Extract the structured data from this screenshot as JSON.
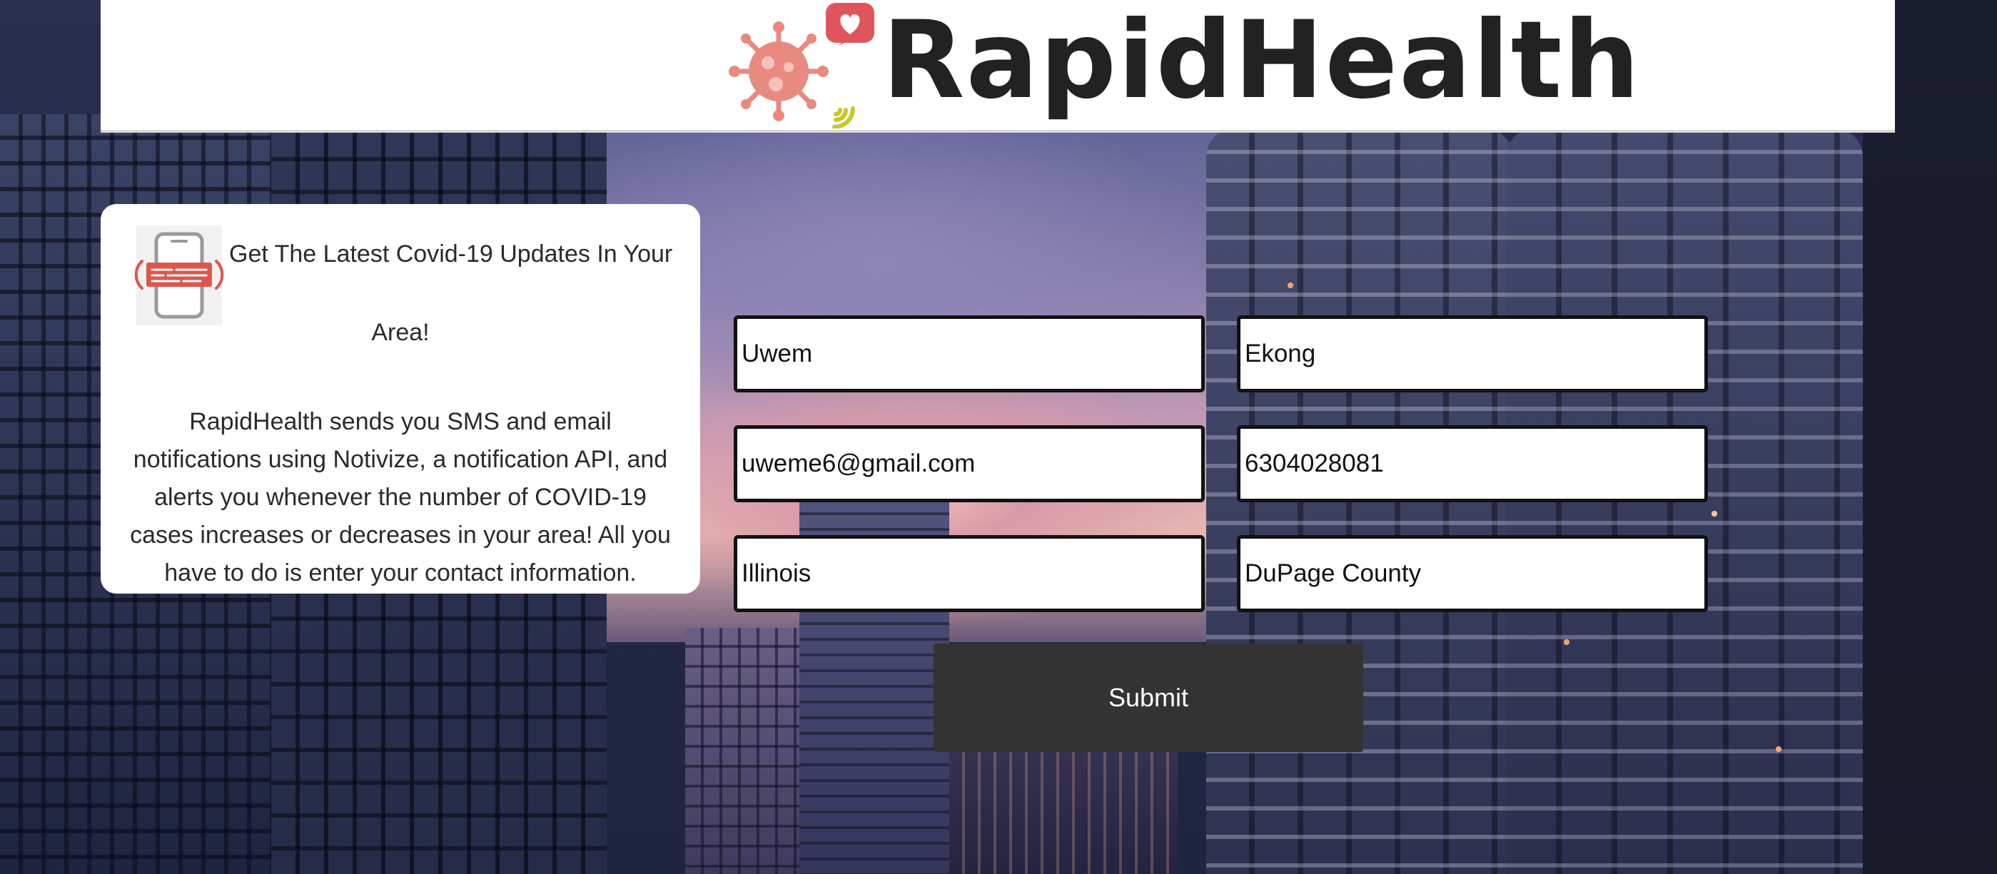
{
  "header": {
    "brand": "RapidHealth"
  },
  "info_card": {
    "heading_line1": "Get The Latest Covid-19 Updates In Your",
    "heading_line2": "Area!",
    "body": "RapidHealth sends you SMS and email notifications using Notivize, a notification API, and alerts you whenever the number of COVID-19 cases increases or decreases in your area! All you have to do is enter your contact information."
  },
  "form": {
    "first_name": "Uwem",
    "last_name": "Ekong",
    "email": "uweme6@gmail.com",
    "phone": "6304028081",
    "state": "Illinois",
    "county": "DuPage County",
    "submit_label": "Submit"
  },
  "colors": {
    "header_bg": "#ffffff",
    "button_bg": "#333333",
    "button_text": "#ffffff",
    "field_border": "#111111",
    "virus_icon": "#e98a80",
    "heart_badge": "#e0555b",
    "signal_waves": "#c8c826"
  },
  "icons": {
    "logo_virus": "virus-icon",
    "logo_heart": "heart-badge-icon",
    "logo_signal": "signal-waves-icon",
    "card_icon": "phone-alert-icon"
  }
}
